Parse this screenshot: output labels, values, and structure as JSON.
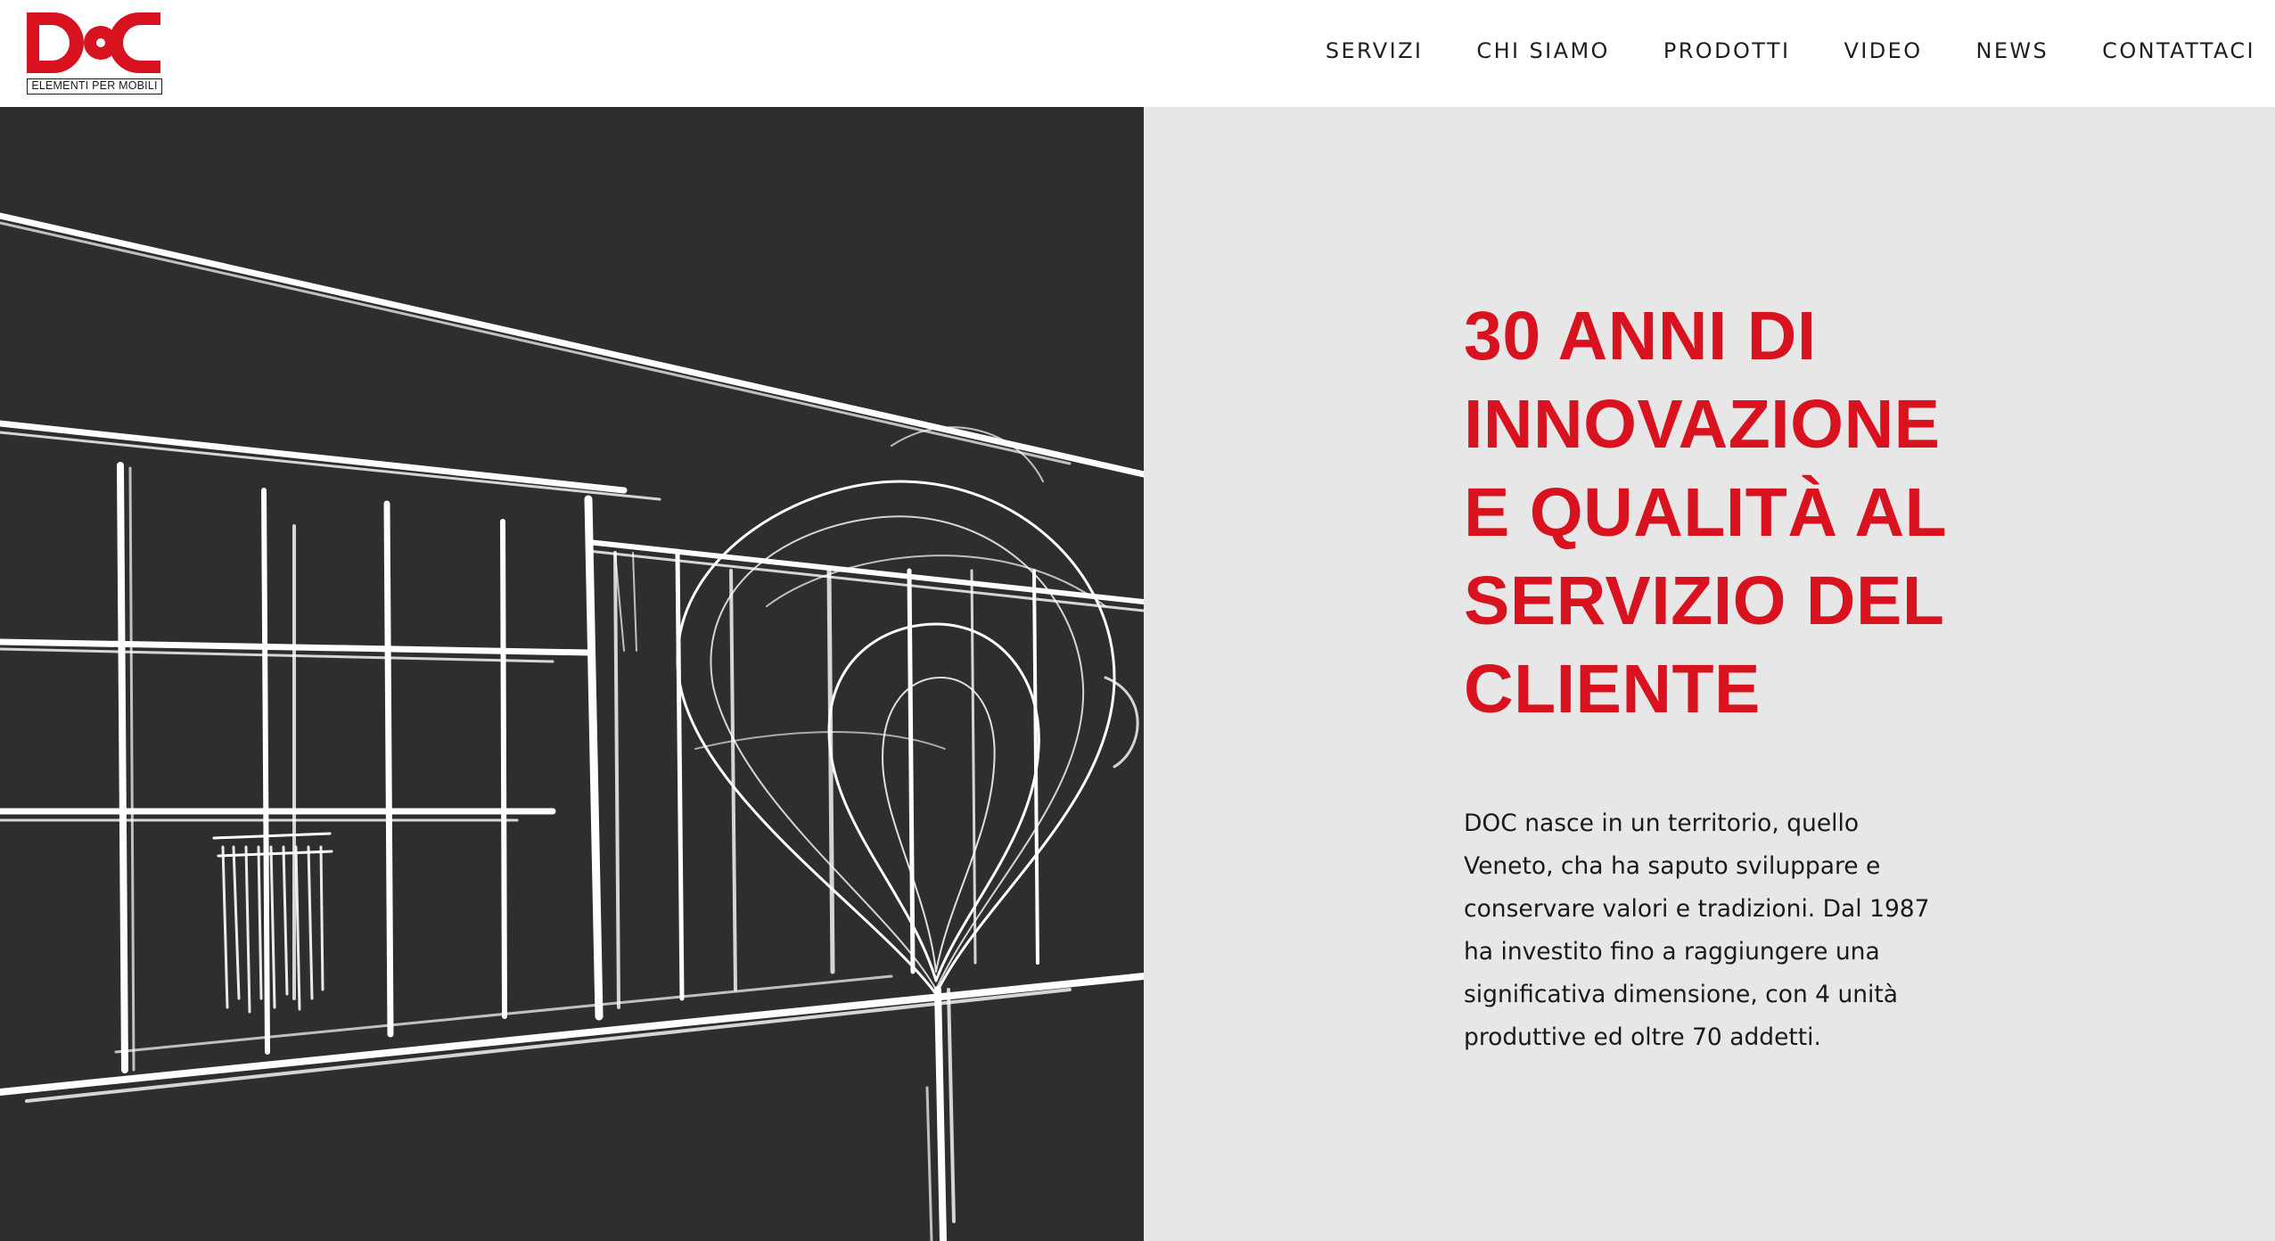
{
  "brand": {
    "logo_text": "DOC",
    "tagline": "ELEMENTI PER MOBILI",
    "accent_color": "#d8121f"
  },
  "nav": {
    "items": [
      {
        "label": "SERVIZI"
      },
      {
        "label": "CHI SIAMO"
      },
      {
        "label": "PRODOTTI"
      },
      {
        "label": "VIDEO"
      },
      {
        "label": "NEWS"
      },
      {
        "label": "CONTATTACI"
      }
    ]
  },
  "hero": {
    "image_description_icon": "building-tree-sketch",
    "headline_lines": [
      "30 ANNI DI",
      "INNOVAZIONE",
      "E QUALITÀ AL",
      "SERVIZIO DEL",
      "CLIENTE"
    ],
    "body_lines": [
      "DOC nasce in un territorio, quello",
      "Veneto, cha ha saputo sviluppare e",
      "conservare valori e tradizioni. Dal 1987",
      "ha investito fino a raggiungere una",
      "significativa dimensione, con 4 unità",
      "produttive ed oltre 70 addetti."
    ]
  },
  "colors": {
    "header_bg": "#ffffff",
    "image_bg": "#2e2e2f",
    "text_panel_bg": "#e7e7e8",
    "headline": "#d8121f",
    "body": "#1a1a1a"
  }
}
